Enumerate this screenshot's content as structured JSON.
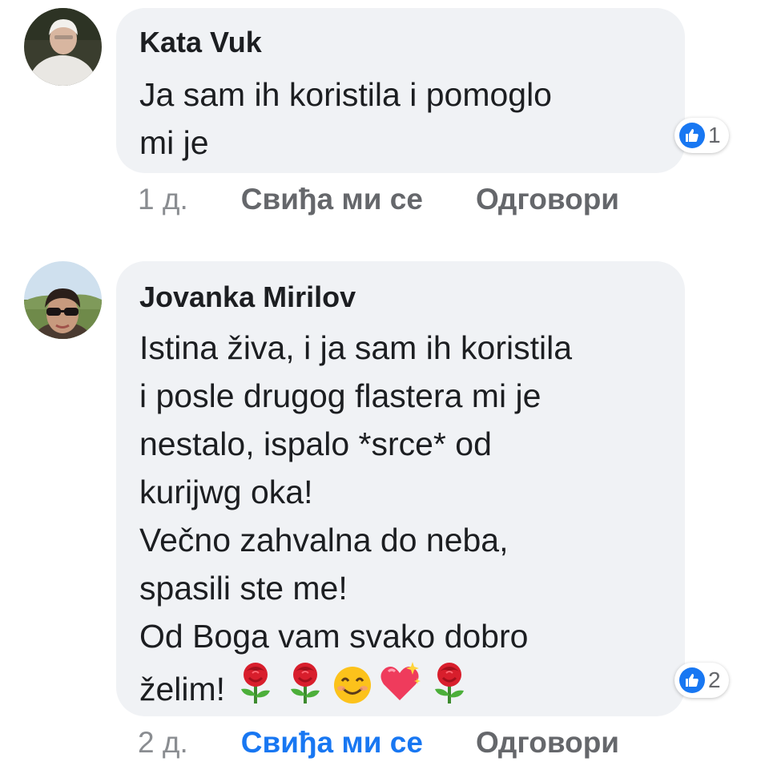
{
  "colors": {
    "bubble_bg": "#f0f2f5",
    "text": "#1c1e21",
    "muted": "#65676b",
    "timestamp": "#8a8d91",
    "accent_blue": "#1877f2"
  },
  "comments": [
    {
      "author": "Kata Vuk",
      "lines": [
        "Ja sam ih koristila i pomoglo",
        "mi je"
      ],
      "reaction_icon": "like-icon",
      "reaction_count": "1",
      "time": "1 д.",
      "like_label": "Свиђа ми се",
      "reply_label": "Одговори",
      "liked_by_viewer": false
    },
    {
      "author": "Jovanka Mirilov",
      "lines": [
        "Istina živa, i ja sam ih koristila",
        "i posle drugog flastera mi je",
        "nestalo, ispalo *srce* od",
        "kurijwg oka!",
        "Večno zahvalna do neba,",
        "spasili ste me!",
        "Od Boga vam svako dobro",
        "želim!"
      ],
      "emojis": [
        "rose-emoji",
        "rose-emoji",
        "smiling-face-emoji",
        "sparkling-heart-emoji",
        "rose-emoji"
      ],
      "reaction_icon": "like-icon",
      "reaction_count": "2",
      "time": "2 д.",
      "like_label": "Свиђа ми се",
      "reply_label": "Одговори",
      "liked_by_viewer": true
    }
  ]
}
